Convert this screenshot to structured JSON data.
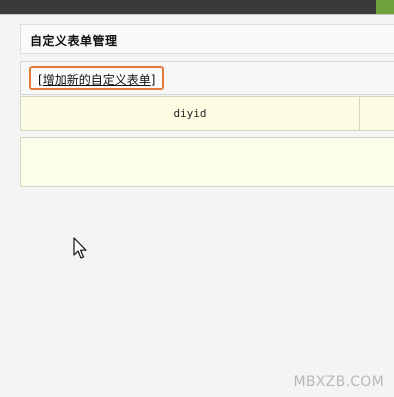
{
  "panel": {
    "title": "自定义表单管理"
  },
  "toolbar": {
    "bracket_open": "[",
    "add_label": "增加新的自定义表单",
    "bracket_close": "]"
  },
  "table": {
    "columns": [
      "diyid",
      ""
    ],
    "rows": []
  },
  "watermark": "MBXZB.COM",
  "colors": {
    "highlight_border": "#e07b3a",
    "header_bg": "#fdfde4",
    "top_bar": "#3a3a3a",
    "top_accent": "#6ea33c"
  },
  "icons": {
    "cursor": "mouse-pointer-icon"
  }
}
